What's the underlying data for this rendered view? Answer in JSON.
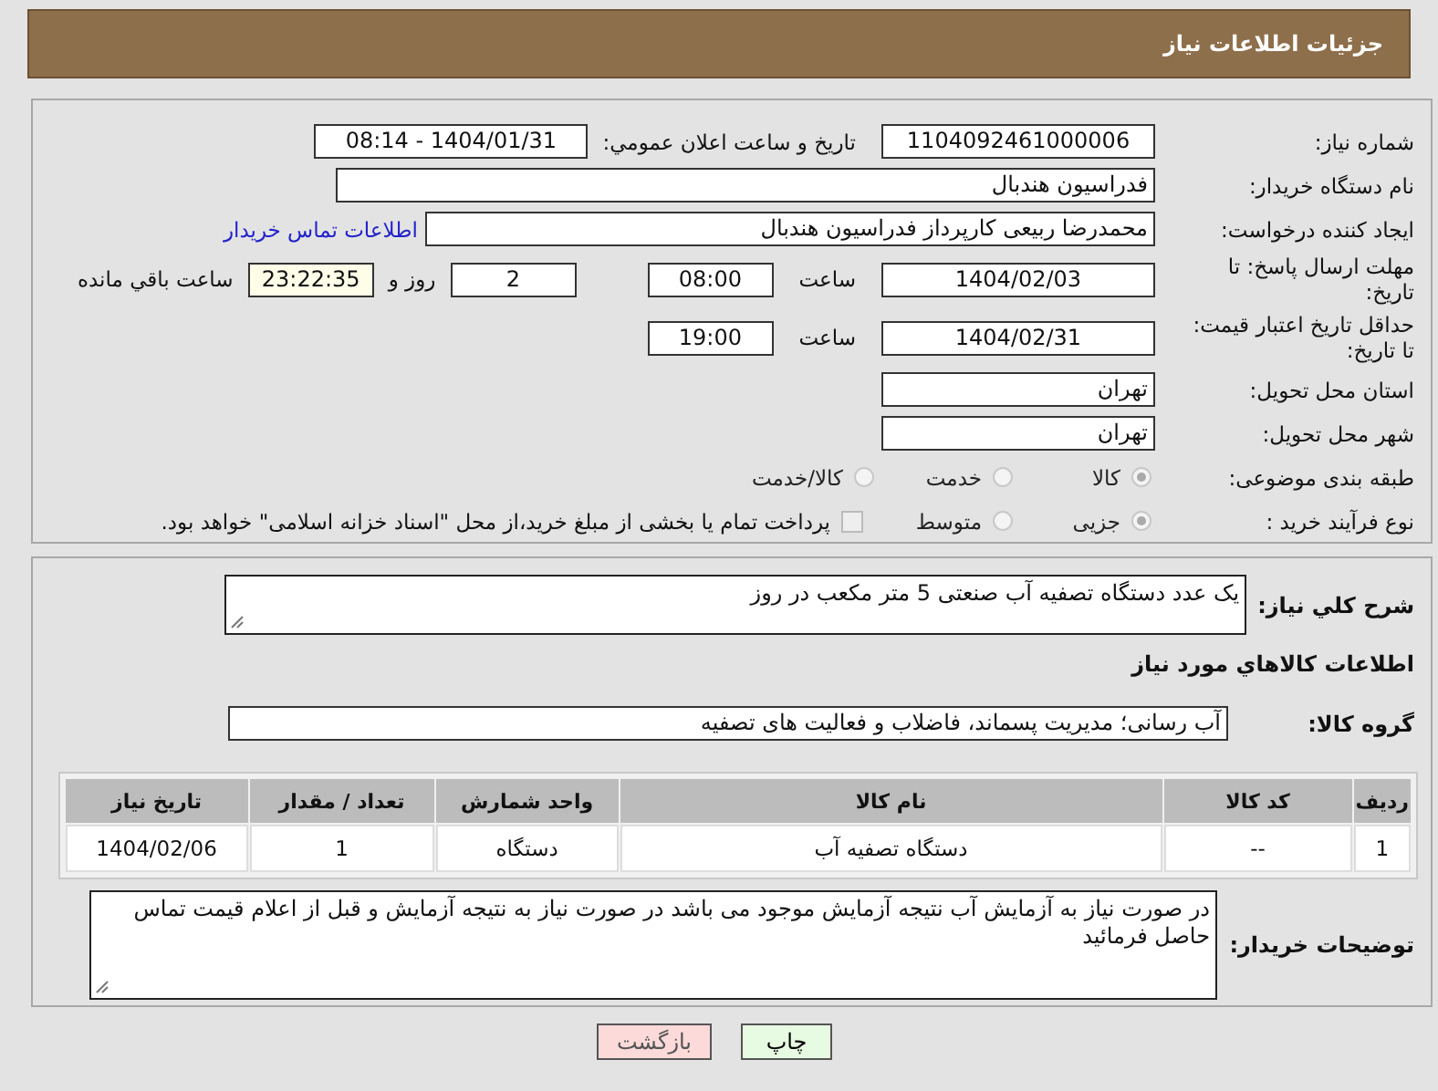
{
  "header": {
    "title": "جزئیات اطلاعات نیاز"
  },
  "need_number": {
    "label": "شماره نیاز:",
    "value": "1104092461000006"
  },
  "announce": {
    "label": "تاریخ و ساعت اعلان عمومي:",
    "value": "1404/01/31 - 08:14"
  },
  "buyer_org": {
    "label": "نام دستگاه خریدار:",
    "value": "فدراسیون هندبال"
  },
  "requester": {
    "label": "ایجاد کننده درخواست:",
    "value": "محمدرضا ربیعی کارپرداز فدراسیون هندبال",
    "link": "اطلاعات تماس خریدار"
  },
  "reply_deadline": {
    "label": "مهلت ارسال پاسخ: تا تاریخ:",
    "date": "1404/02/03",
    "time_label": "ساعت",
    "time": "08:00",
    "days": "2",
    "days_label": "روز و",
    "remaining": "23:22:35",
    "remaining_label": "ساعت باقي مانده"
  },
  "price_validity": {
    "label": "حداقل تاریخ اعتبار قیمت: تا تاریخ:",
    "date": "1404/02/31",
    "time_label": "ساعت",
    "time": "19:00"
  },
  "province": {
    "label": "استان محل تحویل:",
    "value": "تهران"
  },
  "city": {
    "label": "شهر محل تحویل:",
    "value": "تهران"
  },
  "category": {
    "label": "طبقه بندی موضوعی:",
    "options": [
      {
        "label": "كالا",
        "selected": true
      },
      {
        "label": "خدمت",
        "selected": false
      },
      {
        "label": "كالا/خدمت",
        "selected": false
      }
    ]
  },
  "purchase_type": {
    "label": "نوع فرآیند خرید :",
    "options": [
      {
        "label": "جزیی",
        "selected": true
      },
      {
        "label": "متوسط",
        "selected": false
      }
    ],
    "treasury": {
      "checked": false,
      "text": "پرداخت تمام یا بخشی از مبلغ خرید،از محل \"اسناد خزانه اسلامی\" خواهد بود."
    }
  },
  "description": {
    "label": "شرح کلي نیاز:",
    "value": "یک عدد دستگاه تصفیه آب صنعتی 5 متر مکعب در روز"
  },
  "goods_heading": "اطلاعات کالاهاي مورد نیاز",
  "goods_group": {
    "label": "گروه کالا:",
    "value": "آب رسانی؛ مدیریت پسماند، فاضلاب و فعالیت های تصفیه"
  },
  "table": {
    "columns": [
      "ردیف",
      "کد کالا",
      "نام کالا",
      "واحد شمارش",
      "تعداد / مقدار",
      "تاریخ نیاز"
    ],
    "rows": [
      [
        "1",
        "--",
        "دستگاه تصفیه آب",
        "دستگاه",
        "1",
        "1404/02/06"
      ]
    ]
  },
  "buyer_notes": {
    "label": "توضیحات خریدار:",
    "value": "در صورت نیاز به آزمایش آب  نتیجه آزمایش موجود می باشد در صورت نیاز به نتیجه آزمایش و قبل از اعلام قیمت تماس حاصل فرمائید"
  },
  "buttons": [
    {
      "label": "چاپ",
      "kind": "print"
    },
    {
      "label": "بازگشت",
      "kind": "back"
    }
  ]
}
